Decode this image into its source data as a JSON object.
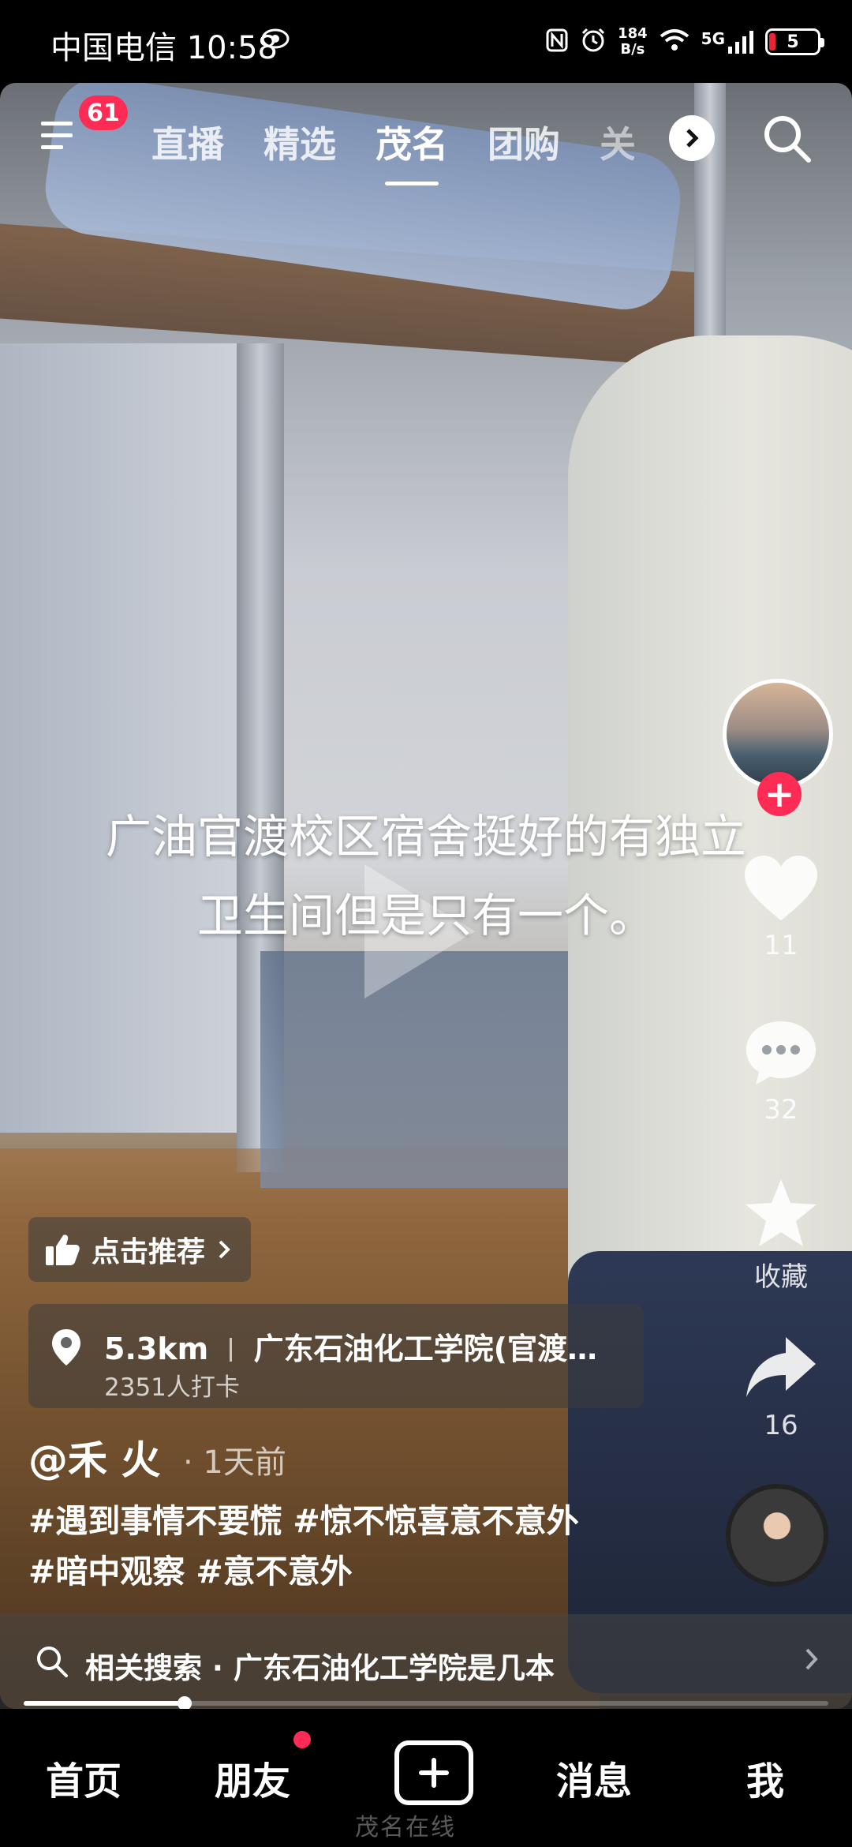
{
  "status_bar": {
    "carrier_time": "中国电信 10:58",
    "net_speed_top": "184",
    "net_speed_bottom": "B/s",
    "signal": "5G",
    "battery": "5"
  },
  "top_nav": {
    "badge_count": "61",
    "tabs": [
      "直播",
      "精选",
      "茂名",
      "团购",
      "关"
    ],
    "active_tab": "茂名"
  },
  "video": {
    "caption_line1": "广油官渡校区宿舍挺好的有独立",
    "caption_line2": "卫生间但是只有一个。"
  },
  "rail": {
    "likes": "11",
    "comments": "32",
    "favorites": "收藏",
    "shares": "16"
  },
  "recommend_label": "点击推荐",
  "location": {
    "distance": "5.3km",
    "place": "广东石油化工学院(官渡…",
    "checkins": "2351人打卡"
  },
  "post": {
    "author": "@禾 火",
    "time": "· 1天前",
    "tags": [
      "#遇到事情不要慌",
      "#惊不惊喜意不意外",
      "#暗中观察",
      "#意不意外"
    ]
  },
  "related_search": "相关搜索 · 广东石油化工学院是几本",
  "progress": 0.2,
  "bottom_nav": {
    "home": "首页",
    "friends": "朋友",
    "messages": "消息",
    "me": "我"
  },
  "watermark": "茂名在线",
  "colors": {
    "accent": "#fe2c55"
  }
}
